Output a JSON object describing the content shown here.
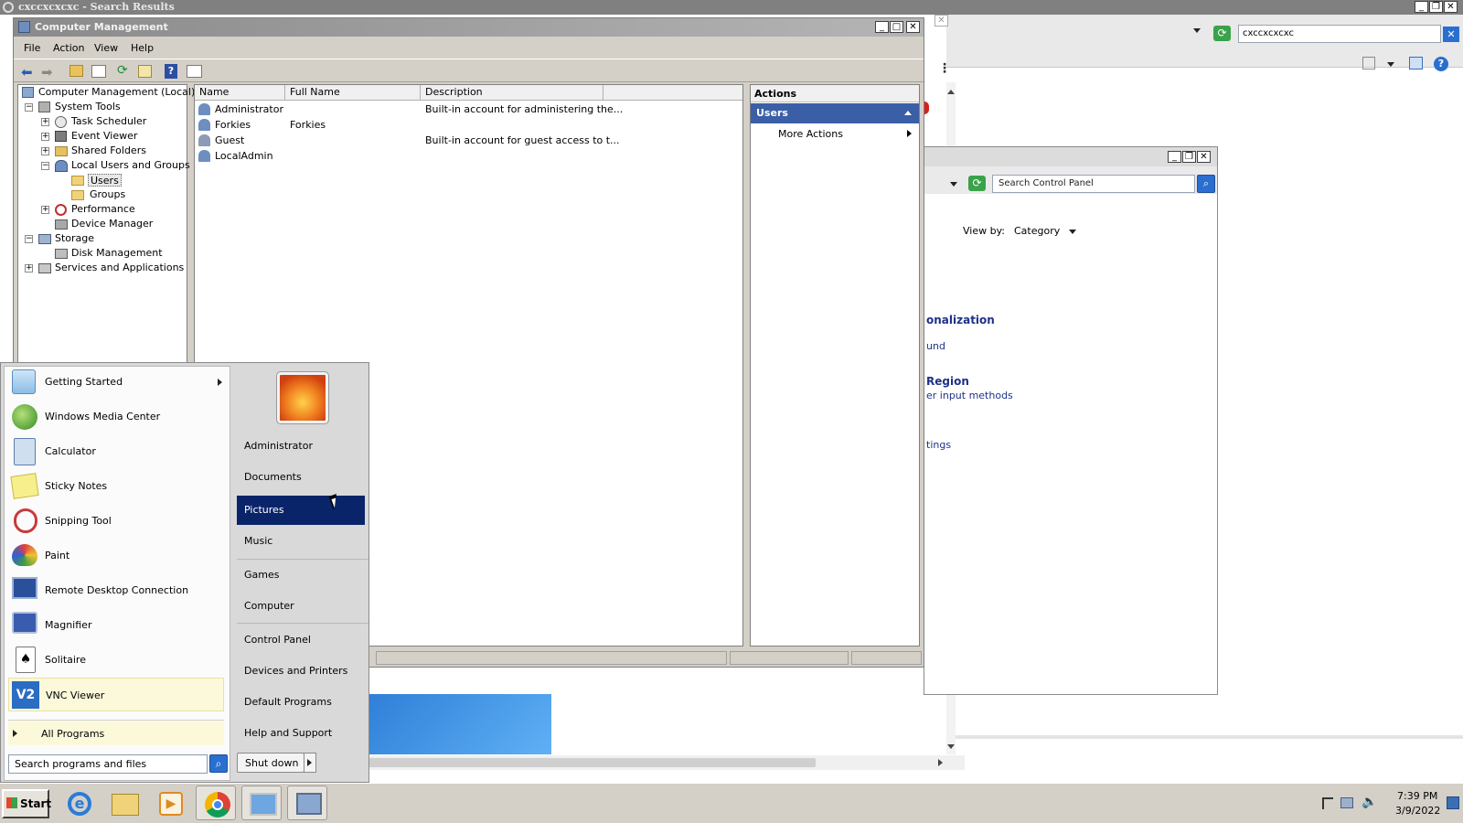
{
  "background_window": {
    "title": "cxccxcxcxc - Search Results",
    "address_value": "cxccxcxcxc"
  },
  "computer_management": {
    "title": "Computer Management",
    "menu": [
      "File",
      "Action",
      "View",
      "Help"
    ],
    "tree": {
      "root": "Computer Management (Local)",
      "system_tools": "System Tools",
      "task_scheduler": "Task Scheduler",
      "event_viewer": "Event Viewer",
      "shared_folders": "Shared Folders",
      "local_users_groups": "Local Users and Groups",
      "users": "Users",
      "groups": "Groups",
      "performance": "Performance",
      "device_manager": "Device Manager",
      "storage": "Storage",
      "disk_management": "Disk Management",
      "services_apps": "Services and Applications"
    },
    "columns": [
      "Name",
      "Full Name",
      "Description"
    ],
    "rows": [
      {
        "name": "Administrator",
        "full_name": "",
        "description": "Built-in account for administering the..."
      },
      {
        "name": "Forkies",
        "full_name": "Forkies",
        "description": ""
      },
      {
        "name": "Guest",
        "full_name": "",
        "description": "Built-in account for guest access to t..."
      },
      {
        "name": "LocalAdmin",
        "full_name": "",
        "description": ""
      }
    ],
    "actions": {
      "header": "Actions",
      "section": "Users",
      "more_actions": "More Actions"
    }
  },
  "control_panel": {
    "search_placeholder": "Search Control Panel",
    "view_by_label": "View by:",
    "view_by_value": "Category",
    "partial_items": [
      "onalization",
      "und",
      "Region",
      "er input methods",
      "tings"
    ]
  },
  "start_menu": {
    "programs": [
      {
        "label": "Getting Started",
        "icon": "getting-started-icon",
        "submenu": true
      },
      {
        "label": "Windows Media Center",
        "icon": "media-center-icon",
        "submenu": false
      },
      {
        "label": "Calculator",
        "icon": "calculator-icon",
        "submenu": false
      },
      {
        "label": "Sticky Notes",
        "icon": "sticky-notes-icon",
        "submenu": false
      },
      {
        "label": "Snipping Tool",
        "icon": "snipping-tool-icon",
        "submenu": false
      },
      {
        "label": "Paint",
        "icon": "paint-icon",
        "submenu": false
      },
      {
        "label": "Remote Desktop Connection",
        "icon": "remote-desktop-icon",
        "submenu": false
      },
      {
        "label": "Magnifier",
        "icon": "magnifier-icon",
        "submenu": false
      },
      {
        "label": "Solitaire",
        "icon": "solitaire-icon",
        "submenu": false
      },
      {
        "label": "VNC Viewer",
        "icon": "vnc-viewer-icon",
        "submenu": false
      }
    ],
    "all_programs": "All Programs",
    "search_placeholder": "Search programs and files",
    "places": [
      "Administrator",
      "Documents",
      "Pictures",
      "Music",
      "Games",
      "Computer",
      "Control Panel",
      "Devices and Printers",
      "Default Programs",
      "Help and Support"
    ],
    "highlighted_place": "Pictures",
    "shutdown": "Shut down"
  },
  "taskbar": {
    "start_label": "Start",
    "pinned": [
      "internet-explorer-icon",
      "explorer-icon",
      "media-player-icon",
      "chrome-icon",
      "control-panel-icon",
      "computer-management-icon"
    ],
    "time": "7:39 PM",
    "date": "3/9/2022"
  },
  "colors": {
    "selection": "#0a246a",
    "actions_header": "#3a5fa6",
    "desktop_blue": "#3c8fe0",
    "taskbar": "#d4d0c8"
  }
}
